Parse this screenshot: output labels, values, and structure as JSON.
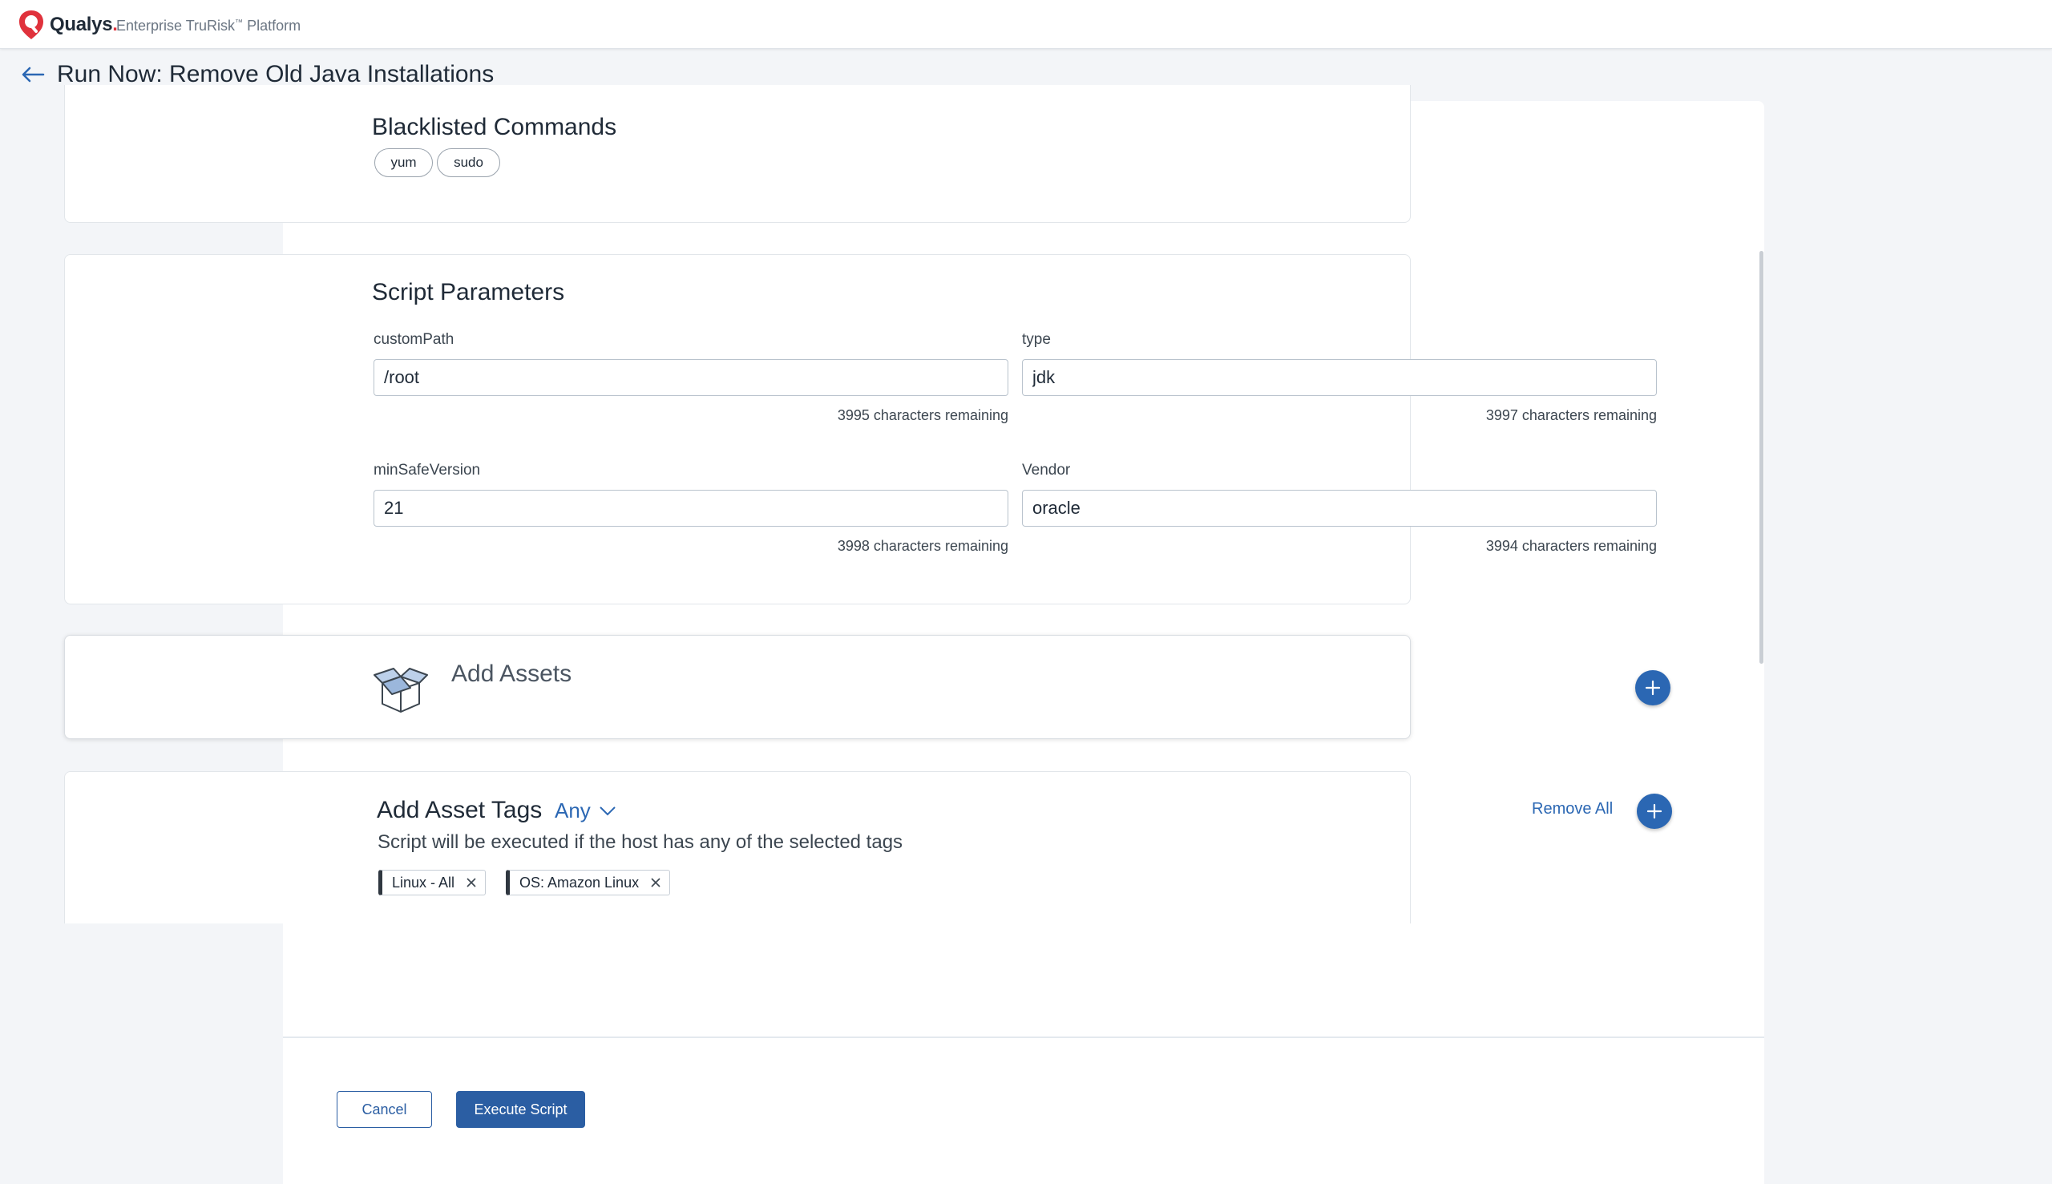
{
  "header": {
    "brand_name": "Qualys",
    "brand_dot": ".",
    "platform_name": "Enterprise TruRisk",
    "platform_tm": "™",
    "platform_suffix": "Platform"
  },
  "page": {
    "title": "Run Now: Remove Old Java Installations"
  },
  "blacklisted_commands": {
    "title": "Blacklisted Commands",
    "items": [
      "yum",
      "sudo"
    ]
  },
  "script_parameters": {
    "title": "Script Parameters",
    "fields": [
      {
        "label": "customPath",
        "value": "/root",
        "remaining": "3995 characters remaining"
      },
      {
        "label": "type",
        "value": "jdk",
        "remaining": "3997 characters remaining"
      },
      {
        "label": "minSafeVersion",
        "value": "21",
        "remaining": "3998 characters remaining"
      },
      {
        "label": "Vendor",
        "value": "oracle",
        "remaining": "3994 characters remaining"
      }
    ]
  },
  "add_assets": {
    "title": "Add Assets",
    "icon": "open-box-icon"
  },
  "asset_tags": {
    "title": "Add Asset Tags",
    "match_mode": "Any",
    "description": "Script will be executed if the host has any of the selected tags",
    "remove_all_label": "Remove All",
    "tags": [
      "Linux - All",
      "OS: Amazon Linux"
    ]
  },
  "footer": {
    "cancel_label": "Cancel",
    "execute_label": "Execute Script"
  },
  "colors": {
    "accent": "#2b67b3",
    "brand_red": "#e0323c",
    "primary_button": "#2b5ea3"
  }
}
